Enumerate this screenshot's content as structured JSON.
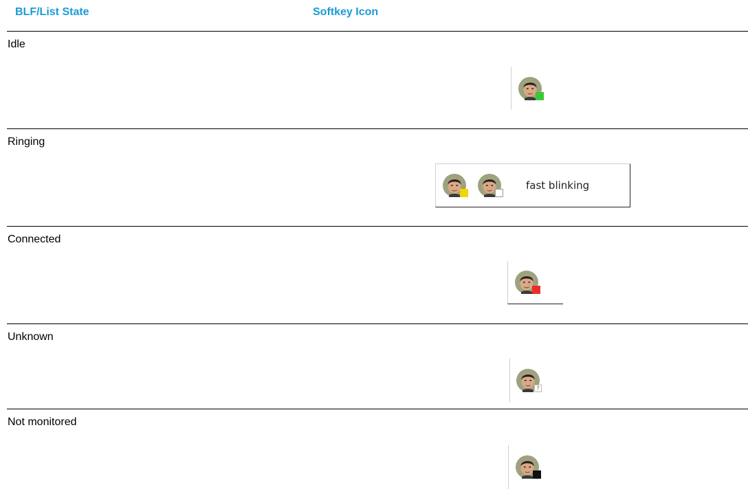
{
  "header": {
    "col1": "BLF/List State",
    "col2": "Softkey Icon"
  },
  "rows": [
    {
      "state": "Idle",
      "icon": "avatar-icon",
      "status_color": "#3cc63c"
    },
    {
      "state": "Ringing",
      "icon": "avatar-icon",
      "status_colors": [
        "#f2d600",
        "#ffffff"
      ],
      "note": "fast blinking"
    },
    {
      "state": "Connected",
      "icon": "avatar-icon",
      "status_color": "#e8302a"
    },
    {
      "state": "Unknown",
      "icon": "avatar-icon",
      "status_mark": "?"
    },
    {
      "state": "Not monitored",
      "icon": "avatar-icon",
      "status_color": "#111111"
    }
  ]
}
